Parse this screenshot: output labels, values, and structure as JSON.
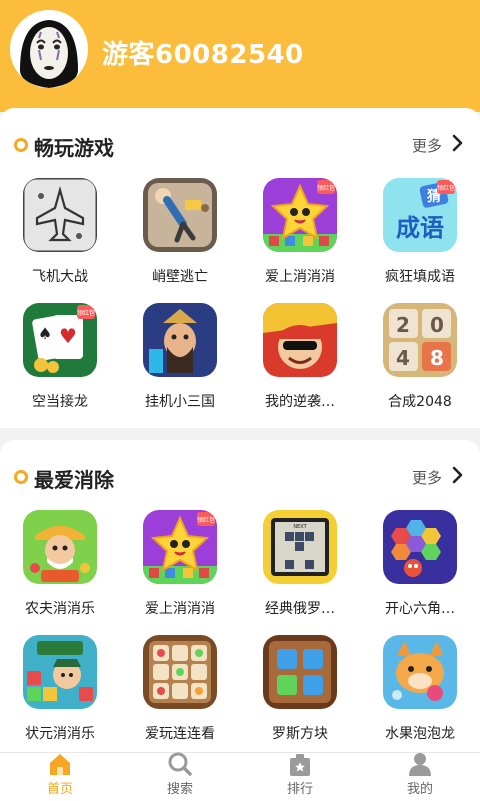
{
  "profile": {
    "username": "游客60082540"
  },
  "sections": [
    {
      "title": "畅玩游戏",
      "more": "更多",
      "games": [
        {
          "label": "飞机大战",
          "icon": "plane-game-icon"
        },
        {
          "label": "峭壁逃亡",
          "icon": "cliff-escape-icon"
        },
        {
          "label": "爱上消消消",
          "icon": "star-match-icon"
        },
        {
          "label": "疯狂填成语",
          "icon": "idiom-icon"
        },
        {
          "label": "空当接龙",
          "icon": "poker-icon"
        },
        {
          "label": "挂机小三国",
          "icon": "three-kingdoms-icon"
        },
        {
          "label": "我的逆袭…",
          "icon": "comeback-icon"
        },
        {
          "label": "合成2048",
          "icon": "2048-icon"
        }
      ]
    },
    {
      "title": "最爱消除",
      "more": "更多",
      "games": [
        {
          "label": "农夫消消乐",
          "icon": "farmer-icon"
        },
        {
          "label": "爱上消消消",
          "icon": "star-match-icon"
        },
        {
          "label": "经典俄罗…",
          "icon": "tetris-icon"
        },
        {
          "label": "开心六角…",
          "icon": "hexagon-icon"
        },
        {
          "label": "状元消消乐",
          "icon": "scholar-icon"
        },
        {
          "label": "爱玩连连看",
          "icon": "link-match-icon"
        },
        {
          "label": "罗斯方块",
          "icon": "block-icon"
        },
        {
          "label": "水果泡泡龙",
          "icon": "fruit-bubble-icon"
        }
      ]
    }
  ],
  "icon_badges": {
    "hongbao": "领红包",
    "tetris_next": "NEXT",
    "idiom_a": "猜",
    "idiom_b": "成语"
  },
  "tile_2048": [
    "2",
    "0",
    "4",
    "8"
  ],
  "nav": [
    {
      "label": "首页",
      "icon": "home-icon",
      "active": true
    },
    {
      "label": "搜索",
      "icon": "search-icon",
      "active": false
    },
    {
      "label": "排行",
      "icon": "ranking-icon",
      "active": false
    },
    {
      "label": "我的",
      "icon": "profile-icon",
      "active": false
    }
  ],
  "colors": {
    "header": "#fcbd3c",
    "accent": "#f5a623",
    "card": "#ffffff",
    "background": "#f2f2f2"
  }
}
